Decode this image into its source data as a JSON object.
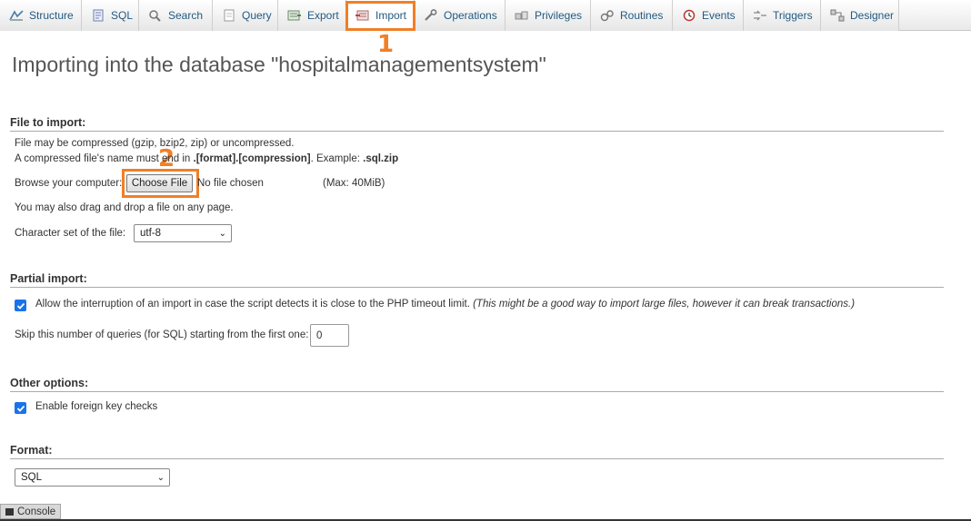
{
  "tabs": [
    {
      "label": "Structure",
      "icon": "structure-icon"
    },
    {
      "label": "SQL",
      "icon": "sql-icon"
    },
    {
      "label": "Search",
      "icon": "search-icon"
    },
    {
      "label": "Query",
      "icon": "query-icon"
    },
    {
      "label": "Export",
      "icon": "export-icon"
    },
    {
      "label": "Import",
      "icon": "import-icon",
      "active": true
    },
    {
      "label": "Operations",
      "icon": "wrench-icon"
    },
    {
      "label": "Privileges",
      "icon": "privileges-icon"
    },
    {
      "label": "Routines",
      "icon": "routines-icon"
    },
    {
      "label": "Events",
      "icon": "clock-icon"
    },
    {
      "label": "Triggers",
      "icon": "triggers-icon"
    },
    {
      "label": "Designer",
      "icon": "designer-icon"
    }
  ],
  "annotations": {
    "step1": "1",
    "step2": "2",
    "color": "#f07f27"
  },
  "page": {
    "title": "Importing into the database \"hospitalmanagementsystem\""
  },
  "file_import": {
    "title": "File to import:",
    "compress_note": "File may be compressed (gzip, bzip2, zip) or uncompressed.",
    "name_note_prefix": "A compressed file's name must end in ",
    "name_note_format": ".[format].[compression]",
    "name_note_example_label": ". Example: ",
    "name_note_example": ".sql.zip",
    "browse_label": "Browse your computer:",
    "choose_file_button": "Choose File",
    "no_file_text": "No file chosen",
    "max_size": "(Max: 40MiB)",
    "drag_note": "You may also drag and drop a file on any page.",
    "charset_label": "Character set of the file:",
    "charset_value": "utf-8"
  },
  "partial_import": {
    "title": "Partial import:",
    "allow_interrupt_label": "Allow the interruption of an import in case the script detects it is close to the PHP timeout limit.",
    "allow_interrupt_note": "(This might be a good way to import large files, however it can break transactions.)",
    "allow_interrupt_checked": true,
    "skip_label": "Skip this number of queries (for SQL) starting from the first one:",
    "skip_value": "0"
  },
  "other_options": {
    "title": "Other options:",
    "foreign_key_label": "Enable foreign key checks",
    "foreign_key_checked": true
  },
  "format": {
    "title": "Format:",
    "value": "SQL"
  },
  "console": {
    "label": "Console"
  }
}
